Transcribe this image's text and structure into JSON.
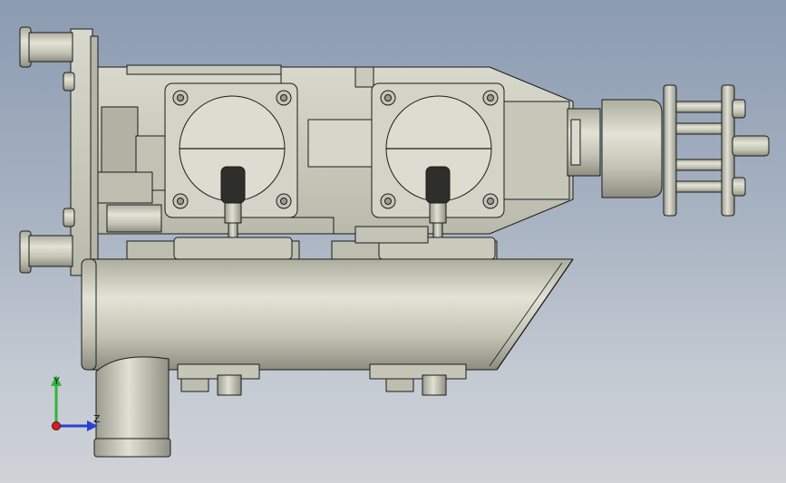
{
  "viewport": {
    "background_top": "#8b9bb1",
    "background_bottom": "#cfd3d8"
  },
  "model": {
    "part_fill": "#cfcfc2",
    "part_shadow": "#9a9a8e",
    "edge_color": "#1c1c1c"
  },
  "triad": {
    "y_label": "Y",
    "z_label": "Z",
    "y_color": "#2fb53a",
    "z_color": "#2a3fd6",
    "x_color": "#d42020"
  }
}
